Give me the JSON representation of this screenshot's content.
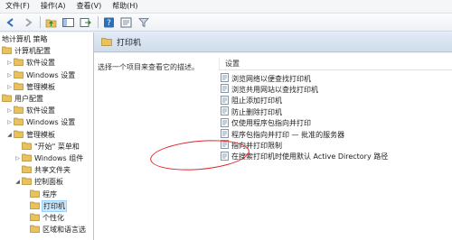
{
  "menu": [
    "文件(F)",
    "操作(A)",
    "查看(V)",
    "帮助(H)"
  ],
  "icons": {
    "toolbar": [
      "back-arrow-icon",
      "forward-arrow-icon",
      "up-folder-icon",
      "show-hide-tree-icon",
      "export-icon",
      "help-icon",
      "properties-icon",
      "filter-icon"
    ],
    "folder": "folder-icon",
    "policy": "policy-setting-icon"
  },
  "colors": {
    "selection": "#cce8ff",
    "highlight_ellipse": "#e0242a",
    "folder": "#e8c25c"
  },
  "tree": {
    "items": [
      {
        "label": "地计算机 策略",
        "indent": 0,
        "tri": "",
        "folder": false
      },
      {
        "label": "计算机配置",
        "indent": 0,
        "tri": "◢",
        "folder": true
      },
      {
        "label": "软件设置",
        "indent": 1,
        "tri": "▷",
        "folder": true
      },
      {
        "label": "Windows 设置",
        "indent": 1,
        "tri": "▷",
        "folder": true
      },
      {
        "label": "管理模板",
        "indent": 1,
        "tri": "▷",
        "folder": true
      },
      {
        "label": "用户配置",
        "indent": 0,
        "tri": "◢",
        "folder": true
      },
      {
        "label": "软件设置",
        "indent": 1,
        "tri": "▷",
        "folder": true
      },
      {
        "label": "Windows 设置",
        "indent": 1,
        "tri": "▷",
        "folder": true
      },
      {
        "label": "管理模板",
        "indent": 1,
        "tri": "◢",
        "folder": true
      },
      {
        "label": "\"开始\" 菜单和",
        "indent": 2,
        "tri": "",
        "folder": true
      },
      {
        "label": "Windows 组件",
        "indent": 2,
        "tri": "▷",
        "folder": true
      },
      {
        "label": "共享文件夹",
        "indent": 2,
        "tri": "",
        "folder": true
      },
      {
        "label": "控制面板",
        "indent": 2,
        "tri": "◢",
        "folder": true
      },
      {
        "label": "程序",
        "indent": 3,
        "tri": "",
        "folder": true
      },
      {
        "label": "打印机",
        "indent": 3,
        "tri": "",
        "folder": true,
        "selected": true
      },
      {
        "label": "个性化",
        "indent": 3,
        "tri": "",
        "folder": true
      },
      {
        "label": "区域和语言选",
        "indent": 3,
        "tri": "",
        "folder": true
      }
    ]
  },
  "pane": {
    "title": "打印机",
    "description": "选择一个项目来查看它的描述。",
    "column_header": "设置",
    "settings": [
      "浏览网络以便查找打印机",
      "浏览共用网站以查找打印机",
      "阻止添加打印机",
      "防止删除打印机",
      "仅使用程序包指向并打印",
      "程序包指向并打印 — 批准的服务器",
      "指向并打印限制",
      "在搜索打印机时使用默认 Active Directory 路径"
    ]
  }
}
